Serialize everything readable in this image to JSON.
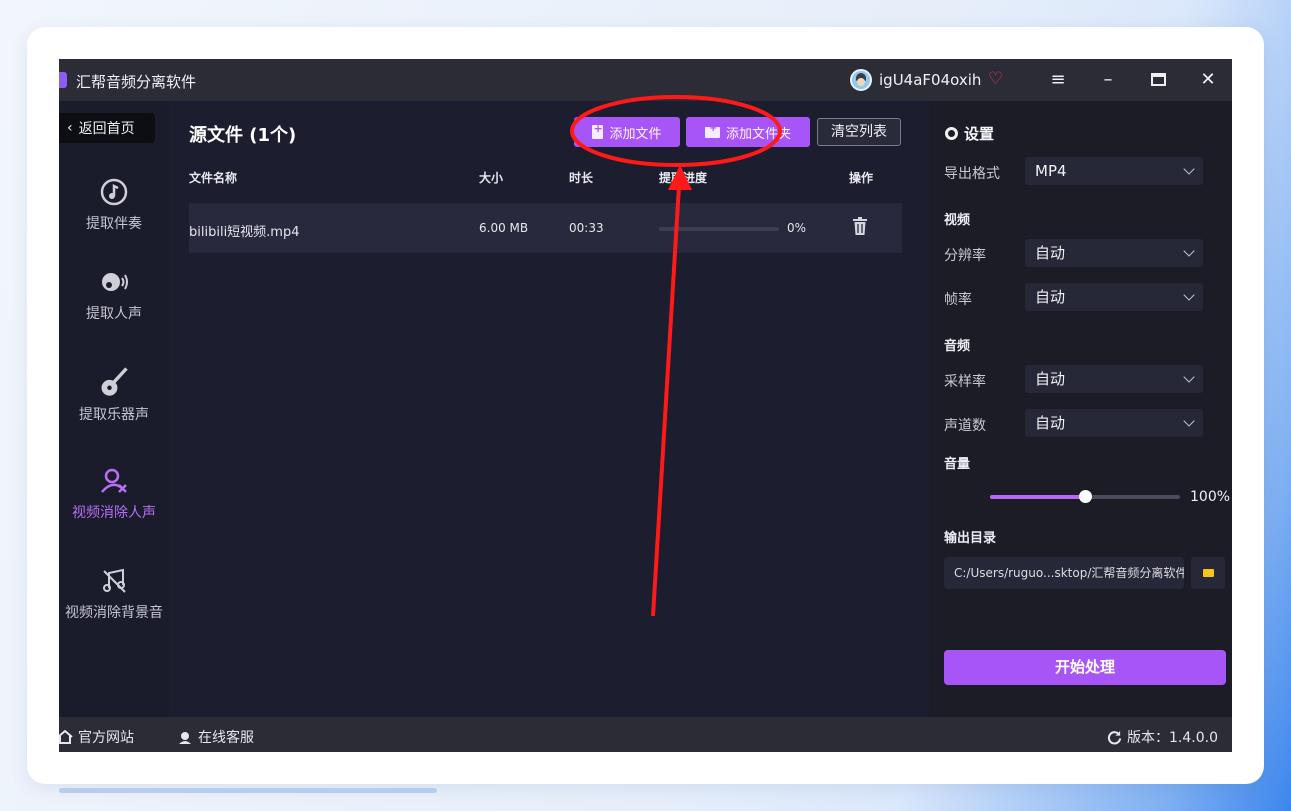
{
  "window": {
    "title": "汇帮音频分离软件",
    "user_name": "igU4aF04oxih",
    "menu_glyph": "≡",
    "minimize_glyph": "–",
    "close_glyph": "✕"
  },
  "sidebar": {
    "back_label": "返回首页",
    "items": [
      {
        "label": "提取伴奏",
        "icon": "music-note-icon"
      },
      {
        "label": "提取人声",
        "icon": "voice-icon"
      },
      {
        "label": "提取乐器声",
        "icon": "guitar-icon"
      },
      {
        "label": "视频消除人声",
        "icon": "remove-person-icon",
        "active": true
      },
      {
        "label": "视频消除背景音",
        "icon": "mute-music-icon"
      }
    ]
  },
  "main": {
    "title": "源文件 (1个)",
    "add_file_label": "添加文件",
    "add_folder_label": "添加文件夹",
    "clear_label": "清空列表",
    "columns": [
      "文件名称",
      "大小",
      "时长",
      "提取进度",
      "操作"
    ],
    "rows": [
      {
        "name": "bilibili短视频.mp4",
        "size": "6.00 MB",
        "duration": "00:33",
        "progress_text": "0%",
        "progress": 0
      }
    ]
  },
  "settings": {
    "title": "设置",
    "export_format_label": "导出格式",
    "export_format_value": "MP4",
    "video_section": "视频",
    "resolution_label": "分辨率",
    "resolution_value": "自动",
    "framerate_label": "帧率",
    "framerate_value": "自动",
    "audio_section": "音频",
    "samplerate_label": "采样率",
    "samplerate_value": "自动",
    "channels_label": "声道数",
    "channels_value": "自动",
    "volume_label": "音量",
    "volume_value": 1.0,
    "volume_text": "100%",
    "output_dir_label": "输出目录",
    "output_dir_value": "C:/Users/ruguo...sktop/汇帮音频分离软件",
    "start_label": "开始处理"
  },
  "footer": {
    "website_label": "官方网站",
    "support_label": "在线客服",
    "version_label": "版本：1.4.0.0"
  },
  "colors": {
    "accent": "#a855f7",
    "annotation": "#ff1a1a"
  }
}
